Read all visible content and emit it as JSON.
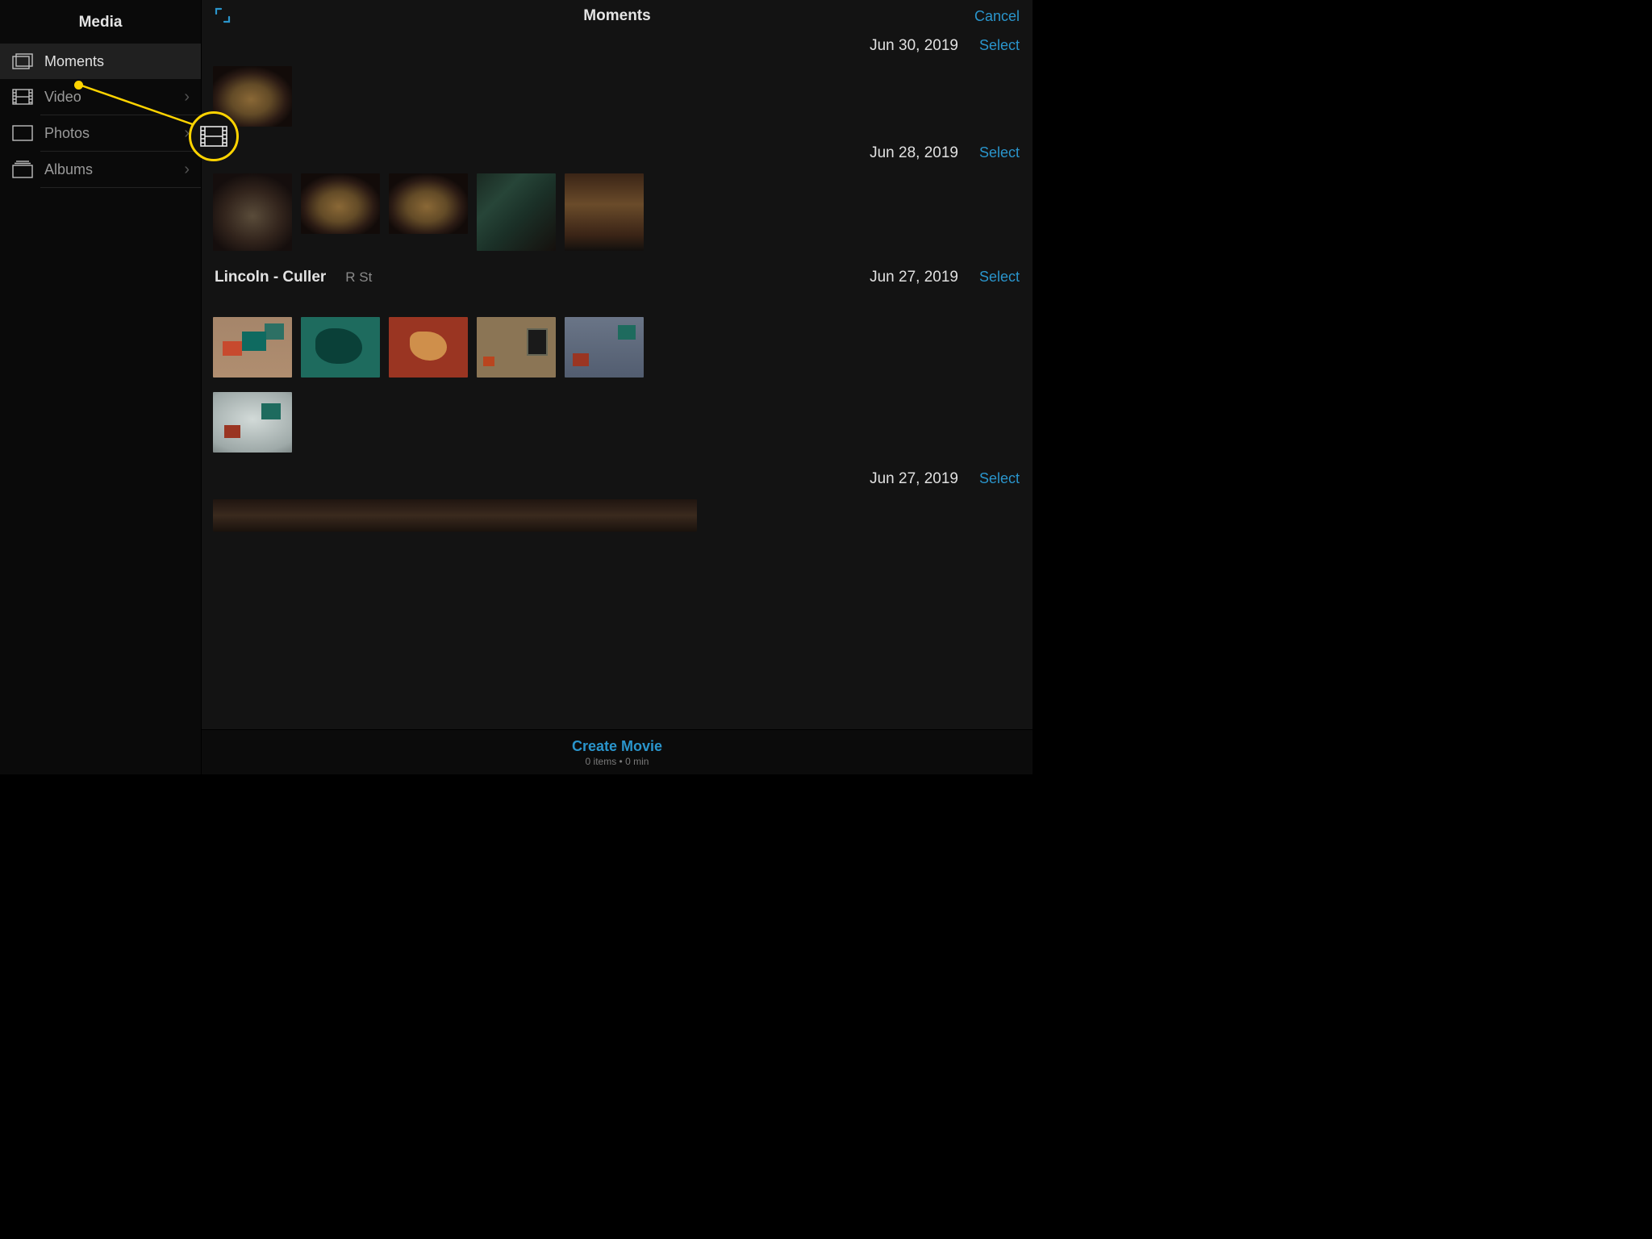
{
  "sidebar": {
    "title": "Media",
    "items": [
      {
        "label": "Moments",
        "icon": "moments-icon",
        "chevron": false,
        "selected": true
      },
      {
        "label": "Video",
        "icon": "film-icon",
        "chevron": true,
        "selected": false
      },
      {
        "label": "Photos",
        "icon": "photo-icon",
        "chevron": true,
        "selected": false
      },
      {
        "label": "Albums",
        "icon": "albums-icon",
        "chevron": true,
        "selected": false
      }
    ]
  },
  "header": {
    "title": "Moments",
    "cancel": "Cancel",
    "expand_icon": "expand-diagonal-icon"
  },
  "sections": [
    {
      "location": "",
      "sub": "",
      "date": "Jun 30, 2019",
      "select": "Select",
      "thumbs": [
        {
          "kind": "dog"
        }
      ]
    },
    {
      "location": "",
      "sub": "",
      "date": "Jun 28, 2019",
      "select": "Select",
      "thumbs": [
        {
          "kind": "cat"
        },
        {
          "kind": "dog"
        },
        {
          "kind": "dog"
        },
        {
          "kind": "blanket"
        },
        {
          "kind": "catsit"
        }
      ]
    },
    {
      "location": "Lincoln - Culler",
      "sub": "R St",
      "date": "Jun 27, 2019",
      "select": "Select",
      "thumbs": [
        {
          "kind": "wall1"
        },
        {
          "kind": "teal"
        },
        {
          "kind": "redb"
        },
        {
          "kind": "gallery"
        },
        {
          "kind": "bluewall"
        },
        {
          "kind": "lightwall"
        }
      ]
    },
    {
      "location": "",
      "sub": "",
      "date": "Jun 27, 2019",
      "select": "Select",
      "thumbs": [
        {
          "kind": "darkstrip"
        }
      ]
    }
  ],
  "footer": {
    "create": "Create Movie",
    "meta": "0 items • 0 min"
  },
  "annotation": {
    "target_label": "Video",
    "callout_icon": "film-icon"
  }
}
